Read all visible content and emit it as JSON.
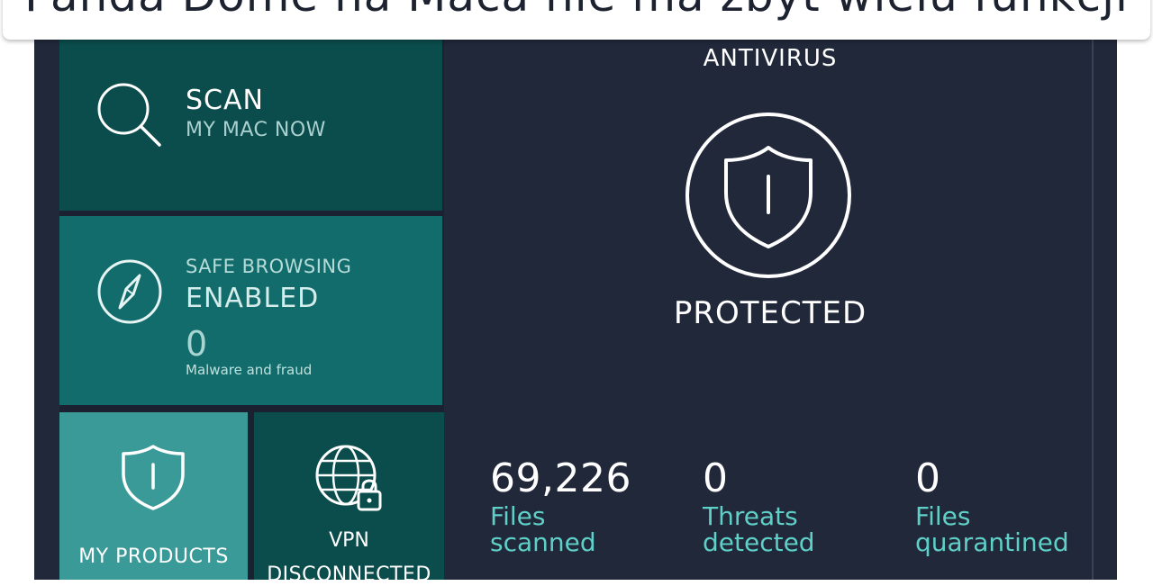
{
  "caption": {
    "text": "Panda Dome na Maca nie ma zbyt wielu funkcji"
  },
  "tiles": {
    "scan": {
      "title": "SCAN",
      "subtitle": "MY MAC NOW",
      "icon": "search-icon"
    },
    "safe_browsing": {
      "label": "SAFE BROWSING",
      "status": "ENABLED",
      "count": "0",
      "caption": "Malware and fraud",
      "icon": "compass-icon"
    },
    "products": {
      "label": "MY PRODUCTS",
      "icon": "shield-icon"
    },
    "vpn": {
      "label": "VPN",
      "status": "DISCONNECTED",
      "icon": "globe-lock-icon"
    }
  },
  "antivirus": {
    "title": "ANTIVIRUS",
    "status": "PROTECTED",
    "icon": "shield-icon",
    "stats": [
      {
        "value": "69,226",
        "label_line1": "Files",
        "label_line2": "scanned"
      },
      {
        "value": "0",
        "label_line1": "Threats",
        "label_line2": "detected"
      },
      {
        "value": "0",
        "label_line1": "Files",
        "label_line2": "quarantined"
      }
    ]
  },
  "colors": {
    "app_background": "#21283a",
    "tile_dark_teal": "#0b4c4c",
    "tile_teal": "#136c6c",
    "tile_light_teal": "#3a9a98",
    "accent_text": "#5fd0c8"
  }
}
